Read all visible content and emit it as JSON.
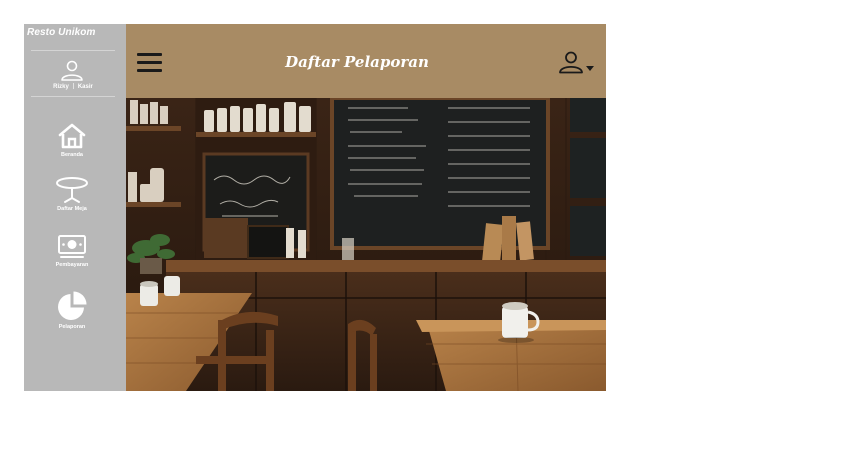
{
  "sidebar": {
    "brand": "Resto Unikom",
    "profile": {
      "name": "Rizky",
      "role": "Kasir",
      "icon": "user-icon"
    },
    "items": [
      {
        "label": "Beranda",
        "icon": "home-icon"
      },
      {
        "label": "Daftar Meja",
        "icon": "table-icon"
      },
      {
        "label": "Pembayaran",
        "icon": "money-icon"
      },
      {
        "label": "Pelaporan",
        "icon": "pie-chart-icon"
      }
    ]
  },
  "header": {
    "title": "Daftar Pelaporan",
    "menu_icon": "hamburger-icon",
    "account_icon": "account-icon"
  },
  "hero": {
    "description_icon": "cafe-photo"
  },
  "colors": {
    "sidebar": "#b8b8b8",
    "header": "#a88b64",
    "text": "#ffffff"
  }
}
